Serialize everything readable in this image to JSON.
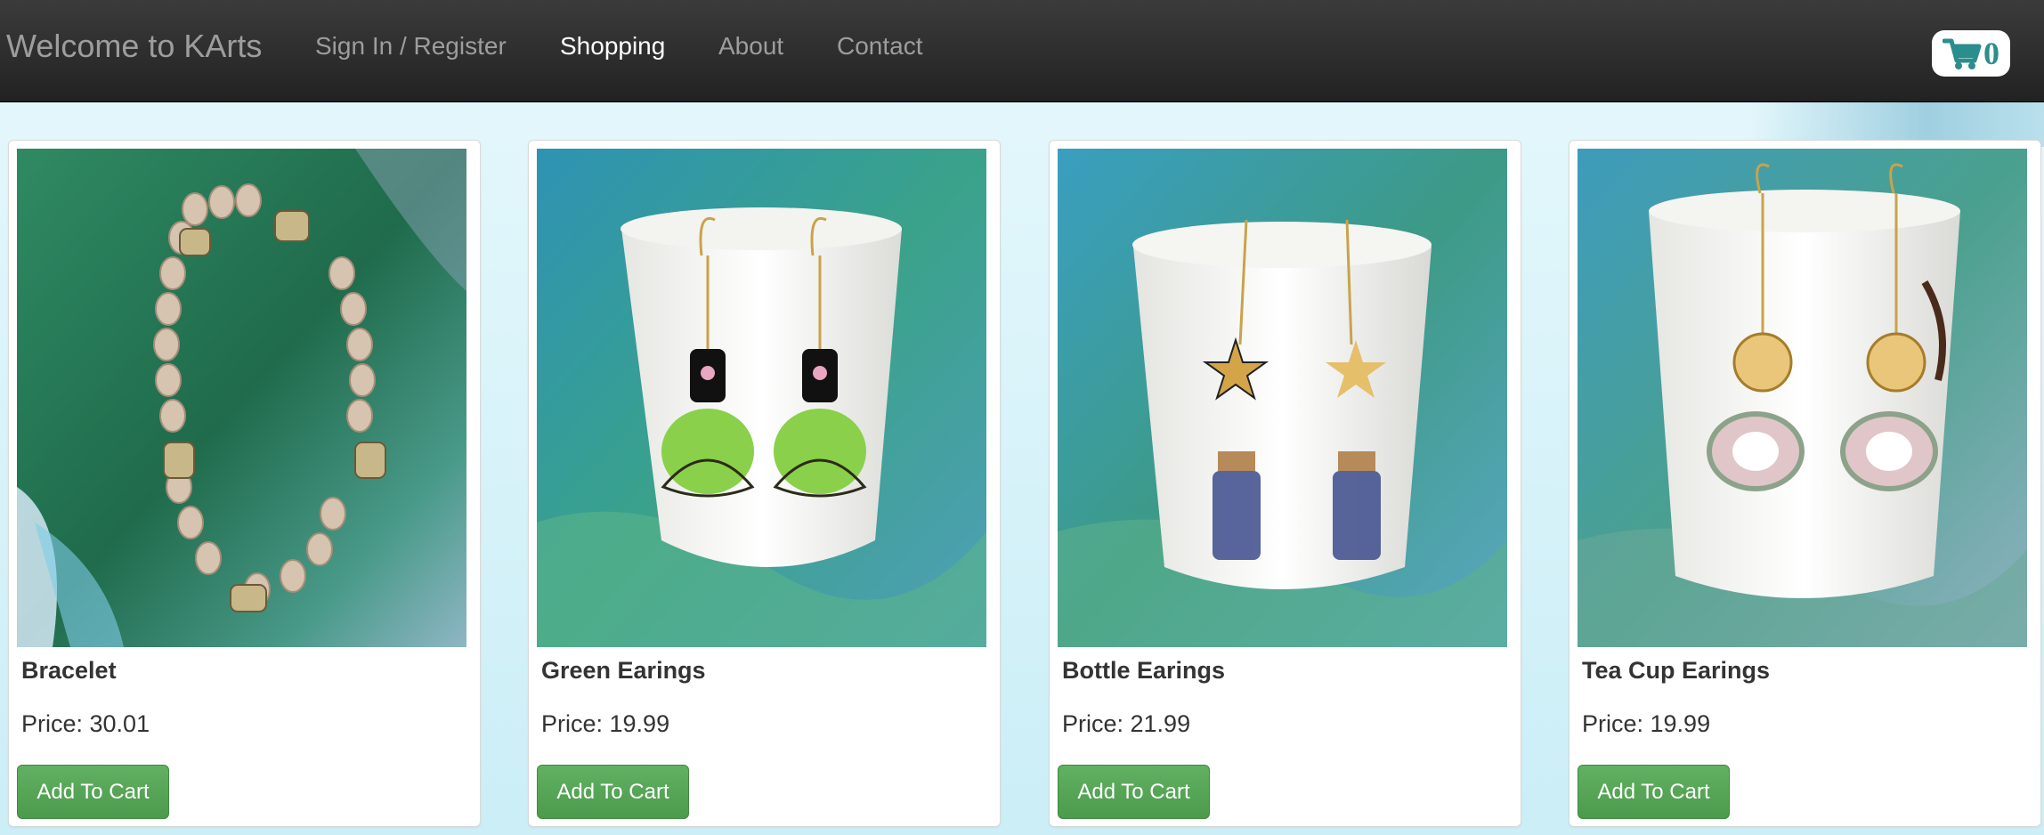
{
  "navbar": {
    "brand": "Welcome to KArts",
    "links": [
      {
        "label": "Sign In / Register"
      },
      {
        "label": "Shopping",
        "active": true
      },
      {
        "label": "About"
      },
      {
        "label": "Contact"
      }
    ],
    "cart": {
      "icon": "cart-icon",
      "count": "0",
      "color": "#2a8e8c"
    }
  },
  "products": [
    {
      "name": "Bracelet",
      "price": "Price: 30.01",
      "button": "Add To Cart",
      "image": "bracelet-photo"
    },
    {
      "name": "Green Earings",
      "price": "Price: 19.99",
      "button": "Add To Cart",
      "image": "green-earrings-photo"
    },
    {
      "name": "Bottle Earings",
      "price": "Price: 21.99",
      "button": "Add To Cart",
      "image": "bottle-earrings-photo"
    },
    {
      "name": "Tea Cup Earings",
      "price": "Price: 19.99",
      "button": "Add To Cart",
      "image": "tea-cup-earrings-photo"
    }
  ],
  "colors": {
    "navbar": "#222222",
    "button": "#5cb85c",
    "background": "#dff5fa"
  }
}
